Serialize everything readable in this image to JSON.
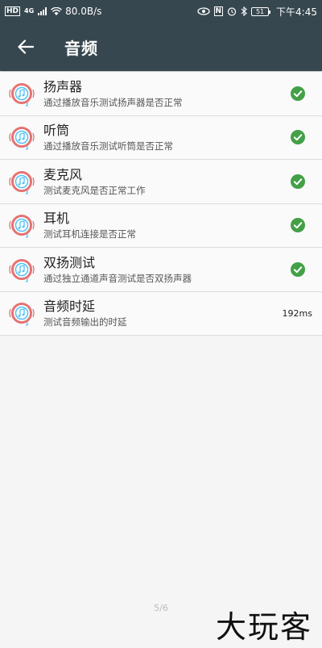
{
  "status_bar": {
    "hd_label": "HD",
    "network_label": "4G",
    "speed": "80.0B/s",
    "nfc_label": "N",
    "battery": "51",
    "time": "下午4:45"
  },
  "app_bar": {
    "title": "音频"
  },
  "items": [
    {
      "title": "扬声器",
      "subtitle": "通过播放音乐测试扬声器是否正常",
      "status": "check"
    },
    {
      "title": "听筒",
      "subtitle": "通过播放音乐测试听筒是否正常",
      "status": "check"
    },
    {
      "title": "麦克风",
      "subtitle": "测试麦克风是否正常工作",
      "status": "check"
    },
    {
      "title": "耳机",
      "subtitle": "测试耳机连接是否正常",
      "status": "check"
    },
    {
      "title": "双扬测试",
      "subtitle": "通过独立通道声音测试是否双扬声器",
      "status": "check"
    },
    {
      "title": "音频时延",
      "subtitle": "测试音频输出的时延",
      "status": "text",
      "value": "192ms"
    }
  ],
  "footer": {
    "page_indicator": "5/6",
    "watermark": "大玩客"
  },
  "colors": {
    "appbar": "#37474f",
    "check": "#43a047",
    "icon_red": "#e57373",
    "icon_blue": "#4fc3f7"
  }
}
